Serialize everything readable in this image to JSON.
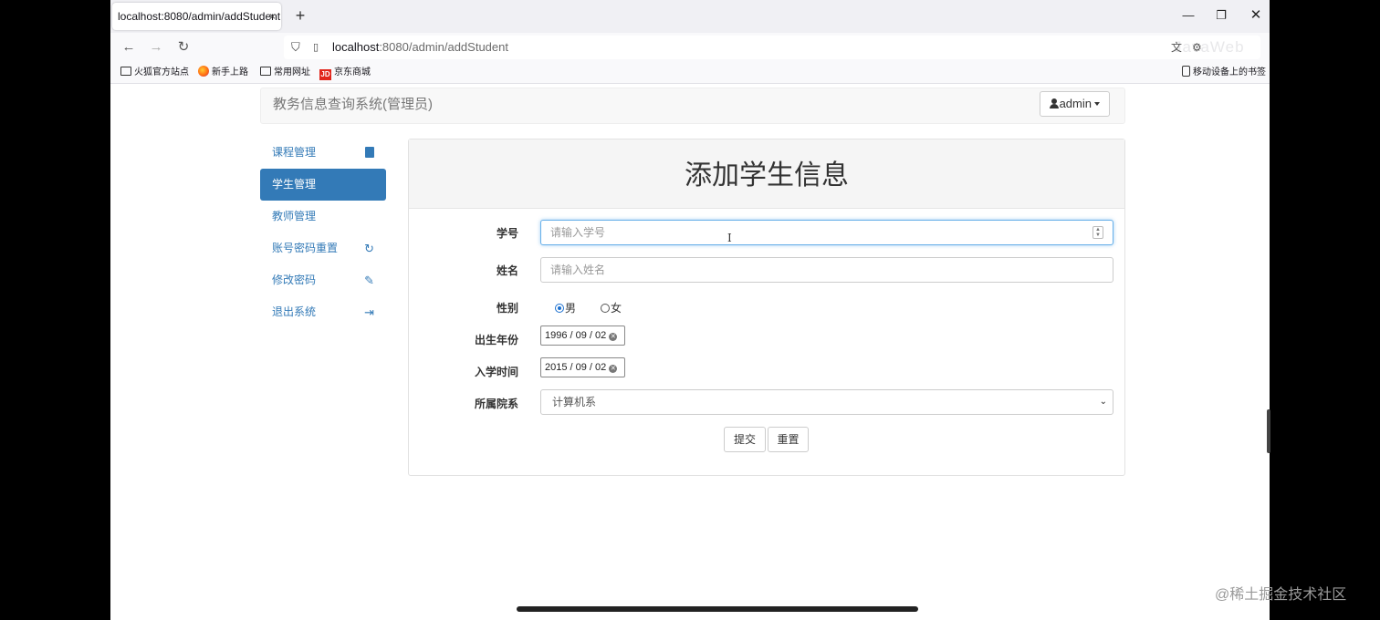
{
  "browser": {
    "tab_title": "localhost:8080/admin/addStudent",
    "tab_close": "×",
    "new_tab": "+",
    "url_host": "localhost",
    "url_rest": ":8080/admin/addStudent",
    "faded_overlay_text": "JavaWeb",
    "bookmarks": [
      "火狐官方站点",
      "新手上路",
      "常用网址",
      "京东商城"
    ],
    "mobile_bookmarks": "移动设备上的书签",
    "jd_badge": "JD"
  },
  "header": {
    "brand": "教务信息查询系统(管理员)",
    "user": "admin"
  },
  "sidebar": {
    "items": [
      {
        "label": "课程管理",
        "icon": "book-icon"
      },
      {
        "label": "学生管理",
        "icon": "user-icon",
        "active": true
      },
      {
        "label": "教师管理",
        "icon": "none"
      },
      {
        "label": "账号密码重置",
        "icon": "refresh-icon"
      },
      {
        "label": "修改密码",
        "icon": "pencil-icon"
      },
      {
        "label": "退出系统",
        "icon": "logout-icon"
      }
    ]
  },
  "form": {
    "title": "添加学生信息",
    "student_id_label": "学号",
    "student_id_placeholder": "请输入学号",
    "name_label": "姓名",
    "name_placeholder": "请输入姓名",
    "gender_label": "性别",
    "gender_male": "男",
    "gender_female": "女",
    "gender_selected": "男",
    "birth_label": "出生年份",
    "birth_value": "1996 / 09 / 02",
    "enroll_label": "入学时间",
    "enroll_value": "2015 / 09 / 02",
    "college_label": "所属院系",
    "college_value": "计算机系",
    "submit": "提交",
    "reset": "重置"
  },
  "watermark": "@稀土掘金技术社区",
  "colors": {
    "primary": "#337ab7",
    "focus_border": "#66afe9"
  }
}
